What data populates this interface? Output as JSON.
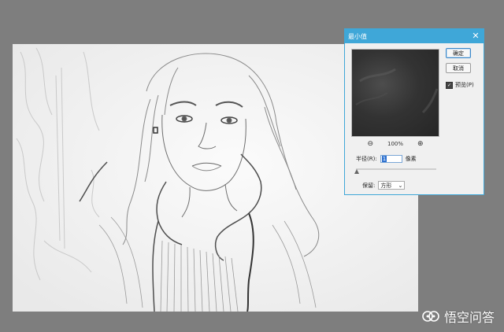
{
  "dialog": {
    "title": "最小值",
    "close_glyph": "✕",
    "ok_label": "确定",
    "cancel_label": "取消",
    "preview_label": "预览(P)",
    "preview_checked": true,
    "zoom_level": "100%",
    "radius_label": "半径(R):",
    "radius_value": "1",
    "radius_unit": "像素",
    "preserve_label": "保留:",
    "preserve_value": "方形"
  },
  "watermark": {
    "text": "悟空问答"
  },
  "icons": {
    "zoom_out": "zoom-out-icon",
    "zoom_in": "zoom-in-icon",
    "close": "close-icon"
  },
  "colors": {
    "titlebar": "#3fa7d8",
    "workspace": "#7e7e7e",
    "canvas": "#f4f4f4"
  }
}
